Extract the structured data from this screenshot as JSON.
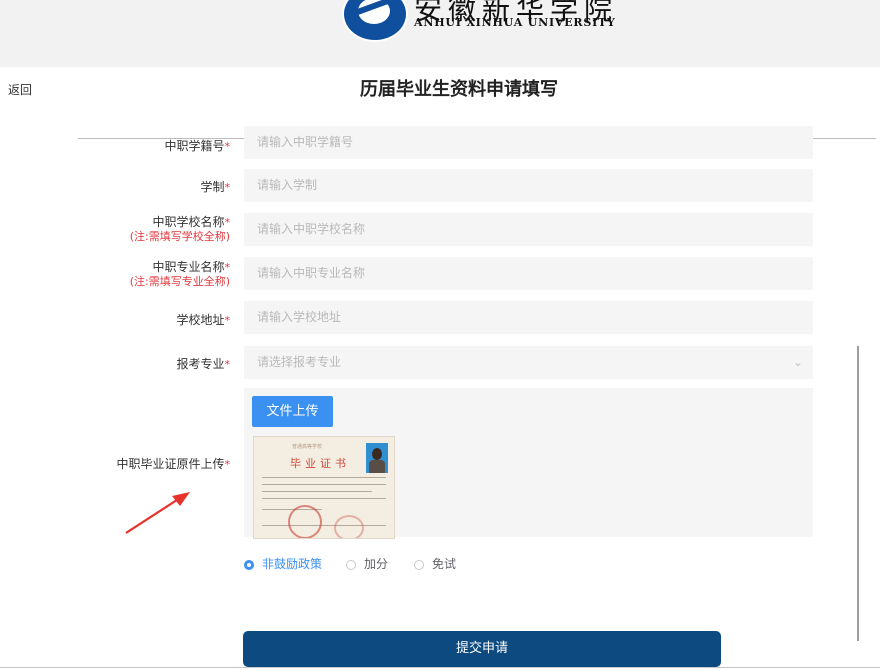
{
  "header": {
    "university_logo_glyphs": "安徽新华学院",
    "university_name_en": "ANHUI XINHUA UNIVERSITY",
    "back_label": "返回",
    "title": "历届毕业生资料申请填写"
  },
  "form": {
    "required_mark": "*",
    "fields": [
      {
        "label": "中职学籍号",
        "placeholder": "请输入中职学籍号"
      },
      {
        "label": "学制",
        "placeholder": "请输入学制"
      },
      {
        "label": "中职学校名称",
        "note": "(注:需填写学校全称)",
        "placeholder": "请输入中职学校名称"
      },
      {
        "label": "中职专业名称",
        "note": "(注:需填写专业全称)",
        "placeholder": "请输入中职专业名称"
      },
      {
        "label": "学校地址",
        "placeholder": "请输入学校地址"
      },
      {
        "label": "报考专业",
        "placeholder": "请选择报考专业"
      }
    ],
    "upload": {
      "label": "中职毕业证原件上传",
      "button_label": "文件上传",
      "certificate_title": "毕业证书",
      "certificate_header": "普通高等学校"
    },
    "policy_options": [
      {
        "label": "非鼓励政策",
        "checked": true
      },
      {
        "label": "加分",
        "checked": false
      },
      {
        "label": "免试",
        "checked": false
      }
    ],
    "submit_label": "提交申请"
  },
  "colors": {
    "primary_blue": "#3a91f1",
    "submit_navy": "#0c4a80",
    "required_red": "#e0393e",
    "input_bg": "#f5f5f5",
    "annotation_arrow": "#e8322c"
  },
  "icons": {
    "select_chevron": "chevron-down-icon",
    "annotation": "red-arrow-icon"
  }
}
